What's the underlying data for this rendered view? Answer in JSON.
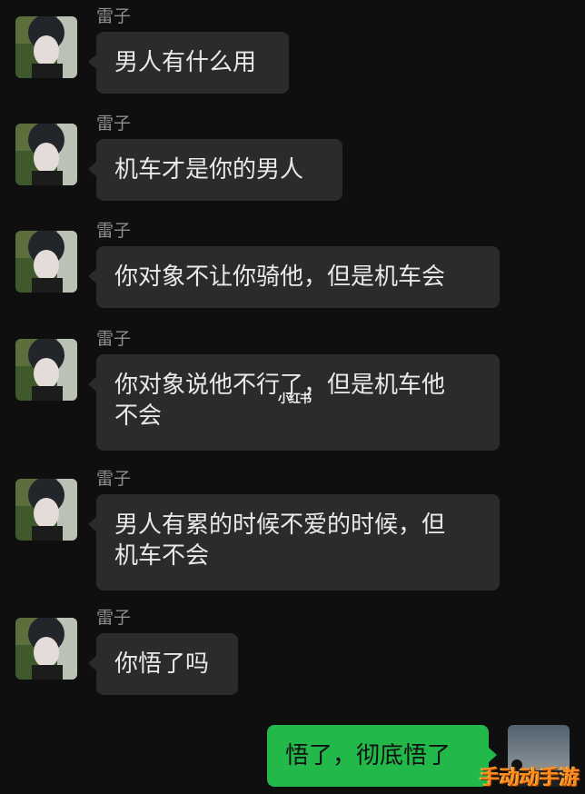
{
  "messages": [
    {
      "sender": "雷子",
      "text": "男人有什么用",
      "side": "left"
    },
    {
      "sender": "雷子",
      "text": "机车才是你的男人",
      "side": "left"
    },
    {
      "sender": "雷子",
      "text": "你对象不让你骑他，但是机车会",
      "side": "left"
    },
    {
      "sender": "雷子",
      "text": "你对象说他不行了，但是机车他\n不会",
      "side": "left"
    },
    {
      "sender": "雷子",
      "text": "男人有累的时候不爱的时候，但\n机车不会",
      "side": "left"
    },
    {
      "sender": "雷子",
      "text": "你悟了吗",
      "side": "left"
    },
    {
      "sender": "",
      "text": "悟了，彻底悟了",
      "side": "right"
    }
  ],
  "watermarks": {
    "inline": "小红书",
    "corner": "手动动手游"
  },
  "colors": {
    "background": "#0f0f0f",
    "incoming_bubble": "#2b2b2b",
    "outgoing_bubble": "#23b84a",
    "sender_name": "#8f8f8f"
  }
}
